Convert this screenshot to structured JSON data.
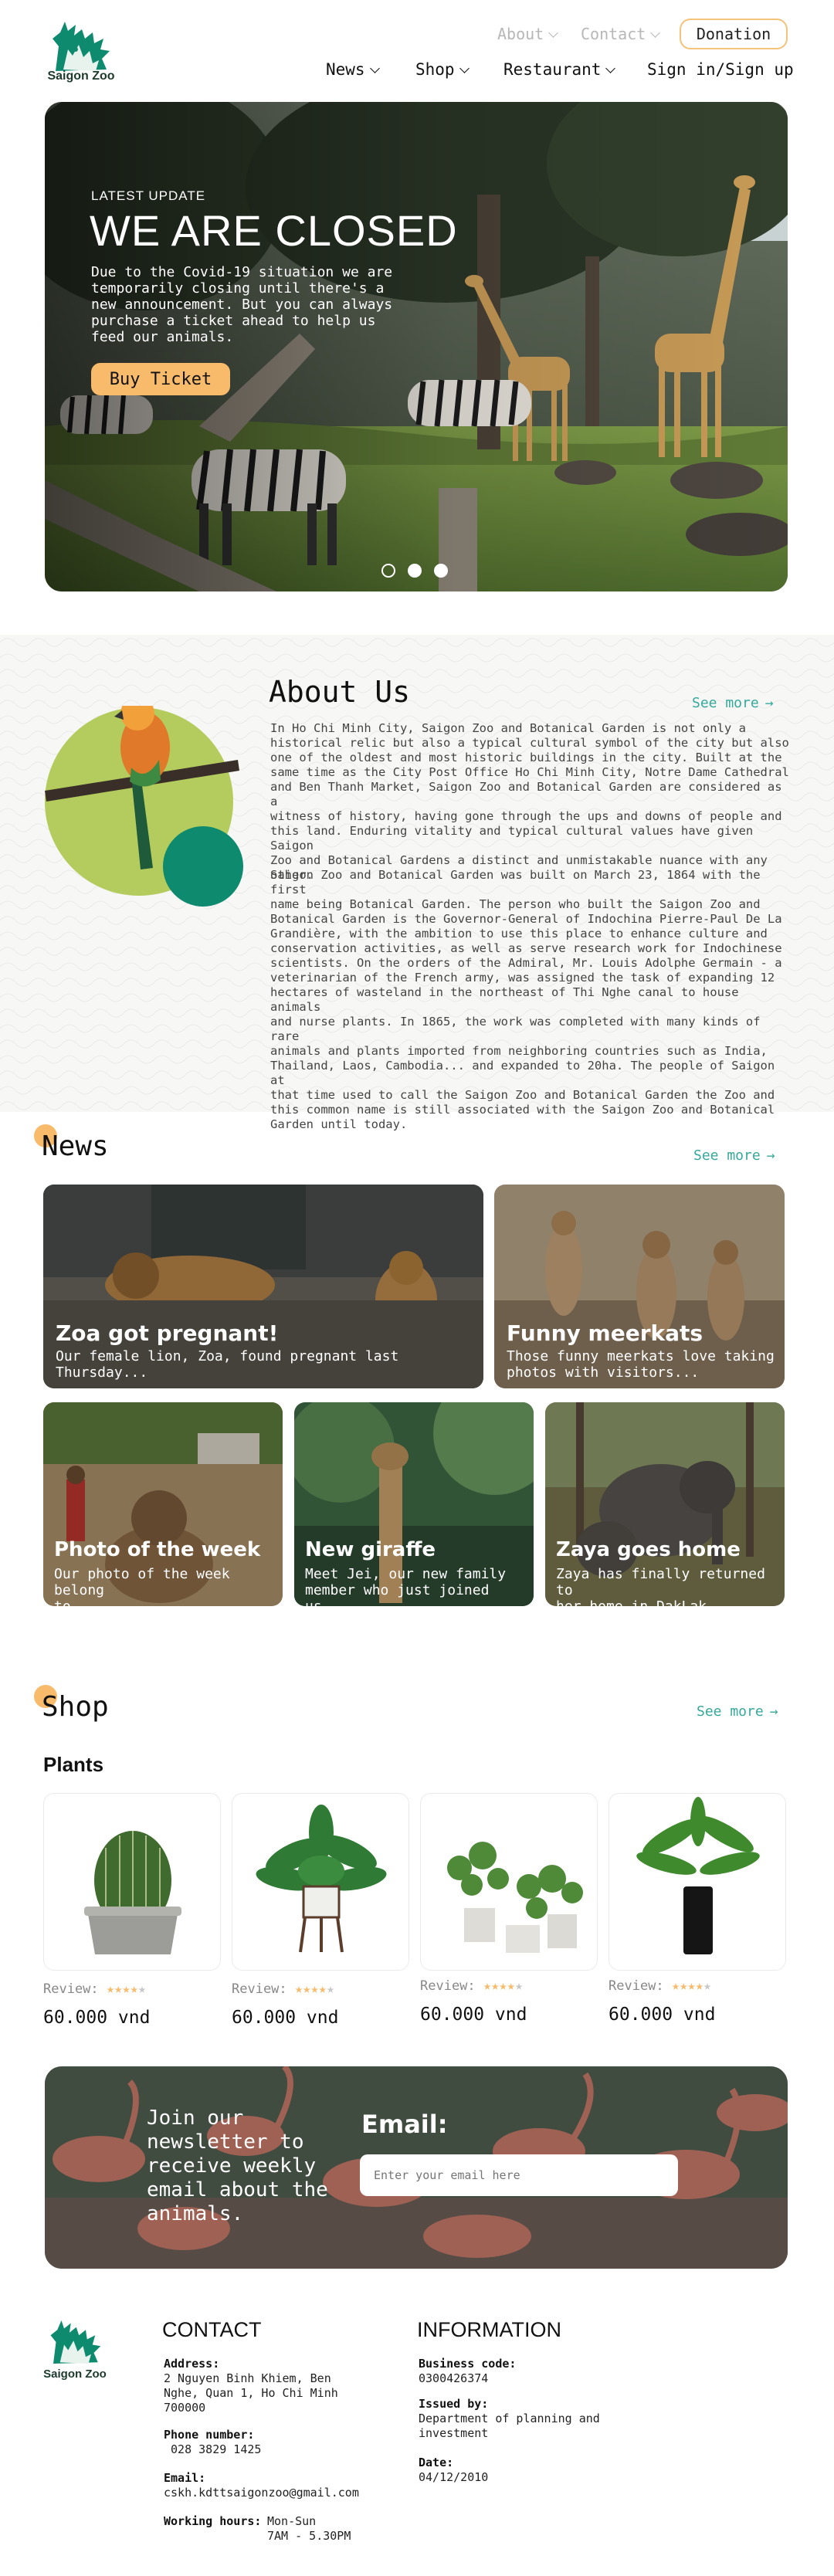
{
  "brand": {
    "name": "Saigon Zoo"
  },
  "topnav": {
    "about": "About",
    "contact": "Contact",
    "donation": "Donation"
  },
  "mainnav": {
    "news": "News",
    "shop": "Shop",
    "restaurant": "Restaurant",
    "signin": "Sign in/Sign up"
  },
  "hero": {
    "kicker": "LATEST UPDATE",
    "title": "WE ARE CLOSED",
    "body": [
      "Due to the Covid-19 situation we are",
      "temporarily closing until there's a",
      "new announcement. But you can always",
      "purchase a ticket ahead to help us",
      "feed our animals."
    ],
    "cta": "Buy Ticket",
    "slides": 3,
    "active_slide": 2
  },
  "about": {
    "title": "About Us",
    "see_more": "See more",
    "p1": [
      "In Ho Chi Minh City, Saigon Zoo and Botanical Garden is not only a",
      "historical relic but also a typical cultural symbol of the city but also",
      "one of the oldest and most historic buildings in the city. Built at the",
      "same time as the City Post Office Ho Chi Minh City, Notre Dame Cathedral",
      "and Ben Thanh Market, Saigon Zoo and Botanical Garden are considered as a",
      "witness of history, having gone through the ups and downs of people and",
      "this land. Enduring vitality and typical cultural values have given Saigon",
      "Zoo and Botanical Gardens a distinct and unmistakable nuance with any",
      "other."
    ],
    "p2": [
      "Saigon Zoo and Botanical Garden was built on March 23, 1864 with the first",
      "name being Botanical Garden. The person who built the Saigon Zoo and",
      "Botanical Garden is the Governor-General of Indochina Pierre-Paul De La",
      "Grandière, with the ambition to use this place to enhance culture and",
      "conservation activities, as well as serve research work for Indochinese",
      "scientists. On the orders of the Admiral, Mr. Louis Adolphe Germain - a",
      "veterinarian of the French army, was assigned the task of expanding 12",
      "hectares of wasteland in the northeast of Thi Nghe canal to house animals",
      "and nurse plants. In 1865, the work was completed with many kinds of rare",
      "animals and plants imported from neighboring countries such as India,",
      "Thailand, Laos, Cambodia... and expanded to 20ha. The people of Saigon at",
      "that time used to call the Saigon Zoo and Botanical Garden the Zoo and",
      "this common name is still associated with the Saigon Zoo and Botanical",
      "Garden until today."
    ]
  },
  "news": {
    "title": "News",
    "see_more": "See more",
    "items": [
      {
        "title": "Zoa got pregnant!",
        "desc": [
          "Our female lion, Zoa, found pregnant last",
          "Thursday..."
        ]
      },
      {
        "title": "Funny meerkats",
        "desc": [
          "Those funny meerkats love taking",
          "photos with visitors..."
        ]
      },
      {
        "title": "Photo of the week",
        "desc": [
          "Our photo of the week belong",
          "to..."
        ]
      },
      {
        "title": "New giraffe",
        "desc": [
          "Meet Jei, our new family",
          "member who just joined us..."
        ]
      },
      {
        "title": "Zaya goes home",
        "desc": [
          "Zaya has finally returned to",
          "her home in DakLak..."
        ]
      }
    ]
  },
  "shop": {
    "title": "Shop",
    "see_more": "See more",
    "category": "Plants",
    "review_label": "Review:",
    "products": [
      {
        "icon": "cactus-icon",
        "rating": 4,
        "price": "60.000 vnd"
      },
      {
        "icon": "fern-plant-icon",
        "rating": 4,
        "price": "60.000 vnd"
      },
      {
        "icon": "pilea-plants-icon",
        "rating": 4,
        "price": "60.000 vnd"
      },
      {
        "icon": "tall-plant-icon",
        "rating": 4,
        "price": "60.000 vnd"
      }
    ]
  },
  "newsletter": {
    "text": [
      "Join our",
      "newsletter to",
      "receive weekly",
      "email about the",
      "animals."
    ],
    "email_label": "Email:",
    "placeholder": "Enter your email here"
  },
  "footer": {
    "contact_title": "CONTACT",
    "address_label": "Address:",
    "address": [
      "2 Nguyen Binh Khiem, Ben",
      "Nghe, Quan 1, Ho Chi Minh",
      "700000"
    ],
    "phone_label": "Phone number:",
    "phone": " 028 3829 1425",
    "email_label": "Email:",
    "email": "cskh.kdttsaigonzoo@gmail.com",
    "hours_label": "Working hours:",
    "hours": [
      "Mon-Sun",
      "7AM - 5.30PM"
    ],
    "info_title": "INFORMATION",
    "code_label": "Business code:",
    "code": "0300426374",
    "issued_label": "Issued by:",
    "issued": [
      "Department of planning and",
      "investment"
    ],
    "date_label": "Date:",
    "date": "04/12/2010"
  },
  "colors": {
    "accent": "#f7bb6b",
    "teal": "#35a99a",
    "green": "#0e8a6f",
    "lime": "#b4cc5e"
  }
}
